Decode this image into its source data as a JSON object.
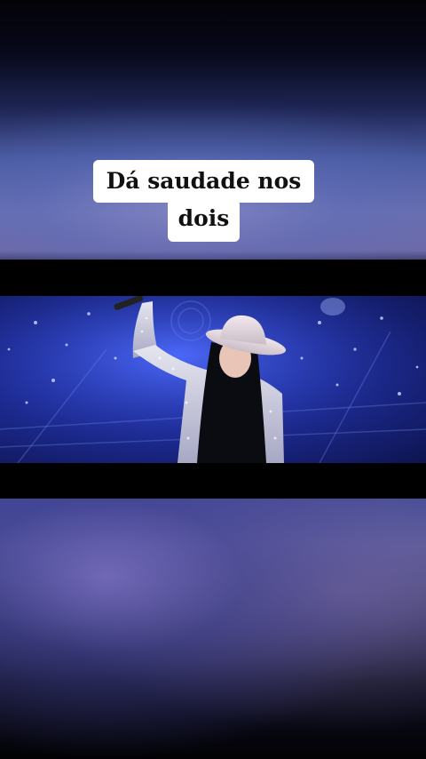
{
  "caption": {
    "line1": "Dá saudade nos",
    "line2": "dois"
  },
  "colors": {
    "caption_bg": "#ffffff",
    "caption_text": "#111111",
    "stage_blue": "#2f47c9",
    "letterbox": "#000000"
  },
  "video": {
    "scene": "performer-on-stage"
  }
}
